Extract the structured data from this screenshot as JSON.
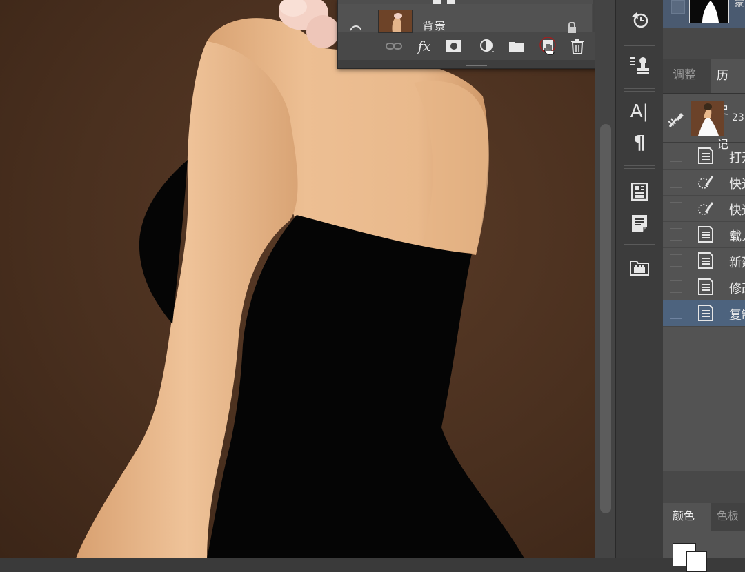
{
  "layers_panel": {
    "layer_name": "背景",
    "icons": [
      "link-icon",
      "fx-icon",
      "mask-icon",
      "adjustment-icon",
      "folder-icon",
      "new-layer-icon",
      "trash-icon"
    ],
    "fx_label": "fx"
  },
  "tool_icons": [
    "history-brush-icon",
    "clone-stamp-icon",
    "character-icon",
    "paragraph-icon",
    "properties-icon",
    "notes-icon",
    "layers-comp-icon"
  ],
  "char_label": "A|",
  "para_label": "¶",
  "right_panel": {
    "top_label": "蒙",
    "tabs": {
      "adjust": "调整",
      "history": "历史记"
    },
    "snapshot_label": "23",
    "history_items": [
      {
        "label": "打开",
        "icon": "document-icon",
        "selected": false
      },
      {
        "label": "快速",
        "icon": "quick-select-icon",
        "selected": false
      },
      {
        "label": "快速",
        "icon": "quick-select-icon",
        "selected": false
      },
      {
        "label": "载入",
        "icon": "document-icon",
        "selected": false
      },
      {
        "label": "新建",
        "icon": "document-icon",
        "selected": false
      },
      {
        "label": "修改",
        "icon": "document-icon",
        "selected": false
      },
      {
        "label": "复制",
        "icon": "document-icon",
        "selected": true
      }
    ],
    "color_tabs": {
      "color": "颜色",
      "swatches": "色板"
    }
  },
  "colors": {
    "background": "#4a301f",
    "skin": "#e8b88c",
    "dress": "#050505",
    "selection": "#4d637e"
  }
}
